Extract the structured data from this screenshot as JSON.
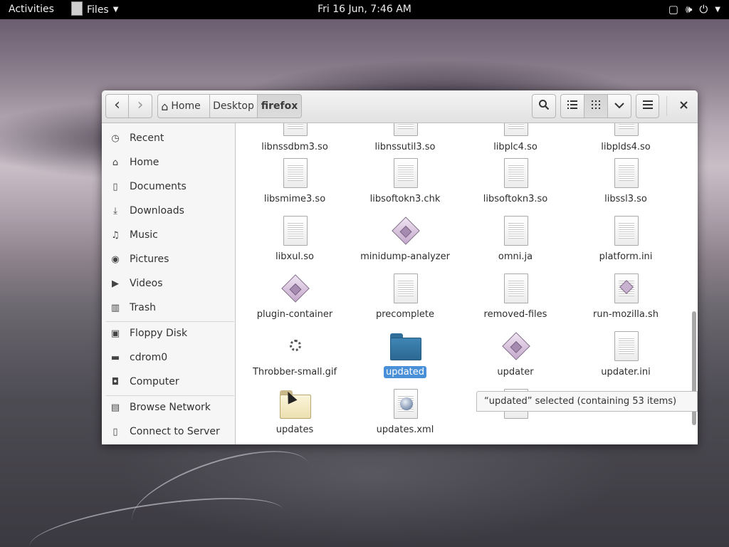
{
  "topbar": {
    "activities": "Activities",
    "app_name": "Files",
    "clock": "Fri 16 Jun,  7:46 AM",
    "icons": [
      "screen-icon",
      "volume-icon",
      "power-icon",
      "chevron-down-icon"
    ]
  },
  "toolbar": {
    "back_glyph": "‹",
    "forward_glyph": "›",
    "breadcrumbs": [
      "Home",
      "Desktop",
      "firefox"
    ],
    "home_glyph": "⌂",
    "search_glyph": "⚲",
    "list_view_glyph": "☰",
    "grid_view_glyph": "⁝⁝",
    "view_options_glyph": "⌄",
    "menu_glyph": "≡",
    "close_glyph": "✕"
  },
  "sidebar": {
    "places": [
      {
        "label": "Recent",
        "icon": "clock-icon",
        "glyph": "◷"
      },
      {
        "label": "Home",
        "icon": "home-icon",
        "glyph": "⌂"
      },
      {
        "label": "Documents",
        "icon": "document-icon",
        "glyph": "▯"
      },
      {
        "label": "Downloads",
        "icon": "download-icon",
        "glyph": "⤓"
      },
      {
        "label": "Music",
        "icon": "music-icon",
        "glyph": "♫"
      },
      {
        "label": "Pictures",
        "icon": "camera-icon",
        "glyph": "◉"
      },
      {
        "label": "Videos",
        "icon": "video-icon",
        "glyph": "▶"
      },
      {
        "label": "Trash",
        "icon": "trash-icon",
        "glyph": "▥"
      }
    ],
    "devices": [
      {
        "label": "Floppy Disk",
        "icon": "floppy-icon",
        "glyph": "▣"
      },
      {
        "label": "cdrom0",
        "icon": "drive-icon",
        "glyph": "▬"
      },
      {
        "label": "Computer",
        "icon": "computer-icon",
        "glyph": "◘"
      }
    ],
    "network": [
      {
        "label": "Browse Network",
        "icon": "network-icon",
        "glyph": "▤"
      },
      {
        "label": "Connect to Server",
        "icon": "server-icon",
        "glyph": "▯"
      }
    ]
  },
  "files": [
    {
      "name": "libnssdbm3.so",
      "icon": "document-icon",
      "type": "doc"
    },
    {
      "name": "libnssutil3.so",
      "icon": "document-icon",
      "type": "doc"
    },
    {
      "name": "libplc4.so",
      "icon": "document-icon",
      "type": "doc"
    },
    {
      "name": "libplds4.so",
      "icon": "document-icon",
      "type": "doc"
    },
    {
      "name": "libsmime3.so",
      "icon": "document-icon",
      "type": "doc"
    },
    {
      "name": "libsoftokn3.chk",
      "icon": "document-icon",
      "type": "doc"
    },
    {
      "name": "libsoftokn3.so",
      "icon": "document-icon",
      "type": "doc"
    },
    {
      "name": "libssl3.so",
      "icon": "document-icon",
      "type": "doc"
    },
    {
      "name": "libxul.so",
      "icon": "document-icon",
      "type": "doc"
    },
    {
      "name": "minidump-analyzer",
      "icon": "executable-icon",
      "type": "exec"
    },
    {
      "name": "omni.ja",
      "icon": "document-icon",
      "type": "doc"
    },
    {
      "name": "platform.ini",
      "icon": "document-icon",
      "type": "doc"
    },
    {
      "name": "plugin-container",
      "icon": "executable-icon",
      "type": "exec"
    },
    {
      "name": "precomplete",
      "icon": "document-icon",
      "type": "doc"
    },
    {
      "name": "removed-files",
      "icon": "document-icon",
      "type": "doc"
    },
    {
      "name": "run-mozilla.sh",
      "icon": "script-icon",
      "type": "script"
    },
    {
      "name": "Throbber-small.gif",
      "icon": "throbber-icon",
      "type": "gif"
    },
    {
      "name": "updated",
      "icon": "folder-icon",
      "type": "folder-blue",
      "selected": true
    },
    {
      "name": "updater",
      "icon": "executable-icon",
      "type": "exec"
    },
    {
      "name": "updater.ini",
      "icon": "document-icon",
      "type": "doc"
    },
    {
      "name": "updates",
      "icon": "folder-icon",
      "type": "folder-tan"
    },
    {
      "name": "updates.xml",
      "icon": "xml-icon",
      "type": "xml"
    },
    {
      "name": "",
      "icon": "document-icon",
      "type": "doc"
    }
  ],
  "status": {
    "text": "“updated” selected  (containing 53 items)"
  }
}
